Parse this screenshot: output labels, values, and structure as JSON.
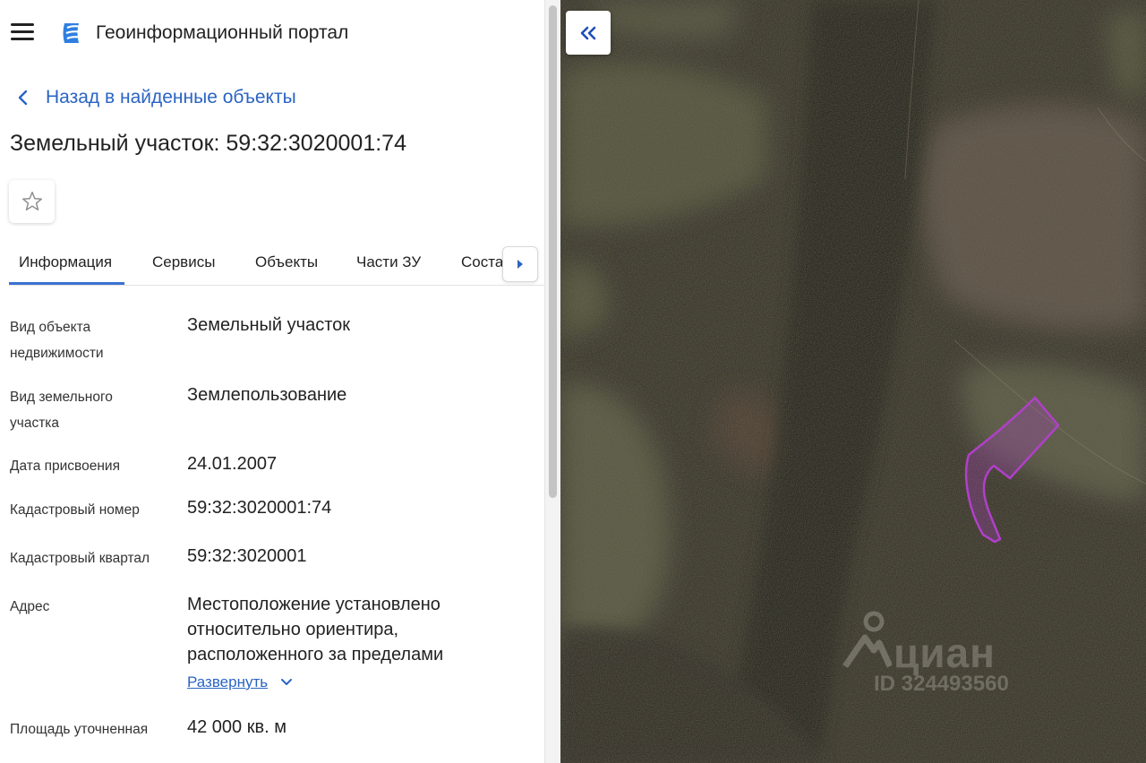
{
  "header": {
    "menu_icon": "hamburger-menu-icon",
    "logo_icon": "portal-logo-icon",
    "title": "Геоинформационный портал"
  },
  "nav": {
    "back_label": "Назад в найденные объекты"
  },
  "object": {
    "title": "Земельный участок: 59:32:3020001:74",
    "favorite_icon": "star-outline-icon"
  },
  "tabs": [
    {
      "label": "Информация",
      "active": true
    },
    {
      "label": "Сервисы",
      "active": false
    },
    {
      "label": "Объекты",
      "active": false
    },
    {
      "label": "Части ЗУ",
      "active": false
    },
    {
      "label": "Соста",
      "active": false
    }
  ],
  "details": {
    "object_type": {
      "label_line1": "Вид объекта",
      "label_line2": "недвижимости",
      "value": "Земельный участок"
    },
    "land_type": {
      "label_line1": "Вид земельного",
      "label_line2": "участка",
      "value": "Землепользование"
    },
    "assign_date": {
      "label": "Дата присвоения",
      "value": "24.01.2007"
    },
    "cadastral_number": {
      "label": "Кадастровый номер",
      "value": "59:32:3020001:74"
    },
    "cadastral_quarter": {
      "label": "Кадастровый квартал",
      "value": "59:32:3020001"
    },
    "address": {
      "label": "Адрес",
      "line1": "Местоположение установлено",
      "line2": "относительно ориентира,",
      "line3": "расположенного за пределами",
      "expand_label": "Развернуть"
    },
    "area": {
      "label": "Площадь уточненная",
      "value": "42 000 кв. м"
    }
  },
  "map": {
    "collapse_icon": "double-chevron-left-icon",
    "parcel_color": "#b040c8",
    "watermark_brand": "циан",
    "watermark_id": "ID 324493560"
  },
  "colors": {
    "accent": "#2a64c4",
    "tab_indicator": "#3a72d2"
  }
}
